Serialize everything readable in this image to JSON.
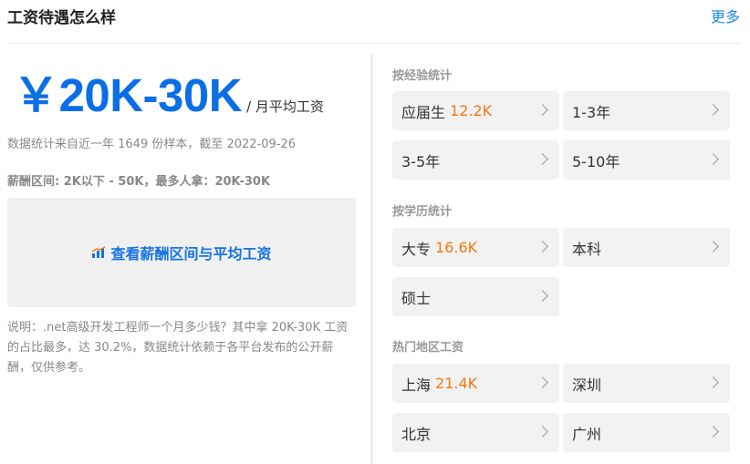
{
  "header": {
    "title": "工资待遇怎么样",
    "more": "更多"
  },
  "summary": {
    "salary": "￥20K-30K",
    "salary_suffix": "/ 月平均工资",
    "stat_note": "数据统计来自近一年 1649 份样本，截至 2022-09-26",
    "range_line": "薪酬区间: 2K以下 - 50K，最多人拿：20K-30K",
    "view_button": "查看薪酬区间与平均工资",
    "description": "说明：.net高级开发工程师一个月多少钱？其中拿 20K-30K 工资的占比最多，达 30.2%，数据统计依赖于各平台发布的公开薪酬，仅供参考。"
  },
  "experience": {
    "label": "按经验统计",
    "items": [
      {
        "label": "应届生",
        "value": "12.2K"
      },
      {
        "label": "1-3年",
        "value": ""
      },
      {
        "label": "3-5年",
        "value": ""
      },
      {
        "label": "5-10年",
        "value": ""
      }
    ]
  },
  "education": {
    "label": "按学历统计",
    "items": [
      {
        "label": "大专",
        "value": "16.6K"
      },
      {
        "label": "本科",
        "value": ""
      },
      {
        "label": "硕士",
        "value": ""
      }
    ]
  },
  "regions": {
    "label": "热门地区工资",
    "items": [
      {
        "label": "上海",
        "value": "21.4K"
      },
      {
        "label": "深圳",
        "value": ""
      },
      {
        "label": "北京",
        "value": ""
      },
      {
        "label": "广州",
        "value": ""
      }
    ]
  },
  "colors": {
    "accent_blue": "#0a6ee6",
    "link_blue": "#1e88e5",
    "value_orange": "#f5760f",
    "chip_bg": "#f2f2f2"
  }
}
